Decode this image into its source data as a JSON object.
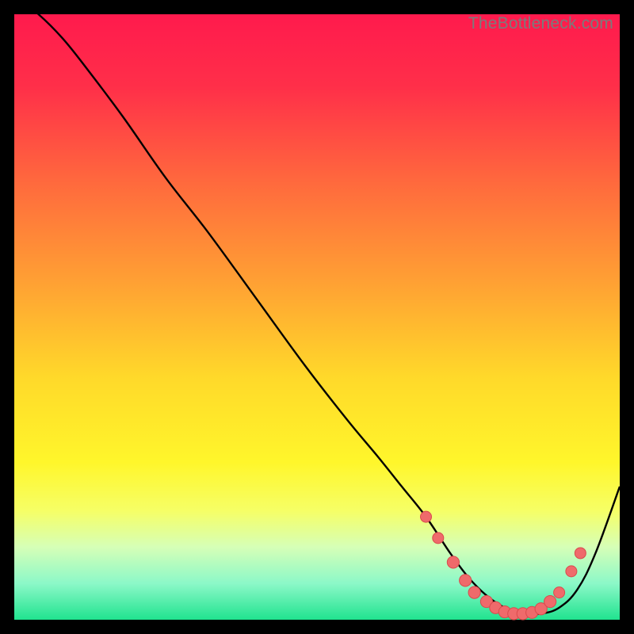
{
  "watermark": "TheBottleneck.com",
  "colors": {
    "gradient_stops": [
      {
        "offset": 0.0,
        "color": "#ff1a4d"
      },
      {
        "offset": 0.12,
        "color": "#ff2f49"
      },
      {
        "offset": 0.28,
        "color": "#ff6a3d"
      },
      {
        "offset": 0.45,
        "color": "#ffa333"
      },
      {
        "offset": 0.6,
        "color": "#ffd92a"
      },
      {
        "offset": 0.74,
        "color": "#fff62b"
      },
      {
        "offset": 0.82,
        "color": "#f6ff66"
      },
      {
        "offset": 0.88,
        "color": "#d6ffb7"
      },
      {
        "offset": 0.94,
        "color": "#8cf8c8"
      },
      {
        "offset": 1.0,
        "color": "#20e38f"
      }
    ],
    "curve": "#000000",
    "markers_fill": "#ef6a6b",
    "markers_stroke": "#d94a4c"
  },
  "chart_data": {
    "type": "line",
    "title": "",
    "xlabel": "",
    "ylabel": "",
    "xlim": [
      0,
      100
    ],
    "ylim": [
      0,
      100
    ],
    "series": [
      {
        "name": "bottleneck-curve",
        "x": [
          0,
          4,
          8,
          12,
          18,
          25,
          32,
          40,
          48,
          55,
          60,
          64,
          68,
          72,
          75,
          78,
          81,
          84,
          87,
          90,
          93,
          96,
          100
        ],
        "y": [
          103,
          100,
          96,
          91,
          83,
          73,
          64,
          53,
          42,
          33,
          27,
          22,
          17,
          11,
          7,
          4,
          2,
          1,
          1,
          2,
          5,
          11,
          22
        ]
      }
    ],
    "markers": {
      "name": "highlight-points",
      "points": [
        {
          "x": 68.0,
          "y": 17.0,
          "r": 1.0
        },
        {
          "x": 70.0,
          "y": 13.5,
          "r": 1.0
        },
        {
          "x": 72.5,
          "y": 9.5,
          "r": 1.2
        },
        {
          "x": 74.5,
          "y": 6.5,
          "r": 1.2
        },
        {
          "x": 76.0,
          "y": 4.5,
          "r": 1.2
        },
        {
          "x": 78.0,
          "y": 3.0,
          "r": 1.2
        },
        {
          "x": 79.5,
          "y": 2.0,
          "r": 1.2
        },
        {
          "x": 81.0,
          "y": 1.3,
          "r": 1.2
        },
        {
          "x": 82.5,
          "y": 1.0,
          "r": 1.2
        },
        {
          "x": 84.0,
          "y": 1.0,
          "r": 1.2
        },
        {
          "x": 85.5,
          "y": 1.2,
          "r": 1.2
        },
        {
          "x": 87.0,
          "y": 1.8,
          "r": 1.2
        },
        {
          "x": 88.5,
          "y": 3.0,
          "r": 1.2
        },
        {
          "x": 90.0,
          "y": 4.5,
          "r": 1.0
        },
        {
          "x": 92.0,
          "y": 8.0,
          "r": 1.0
        },
        {
          "x": 93.5,
          "y": 11.0,
          "r": 1.0
        }
      ]
    }
  }
}
